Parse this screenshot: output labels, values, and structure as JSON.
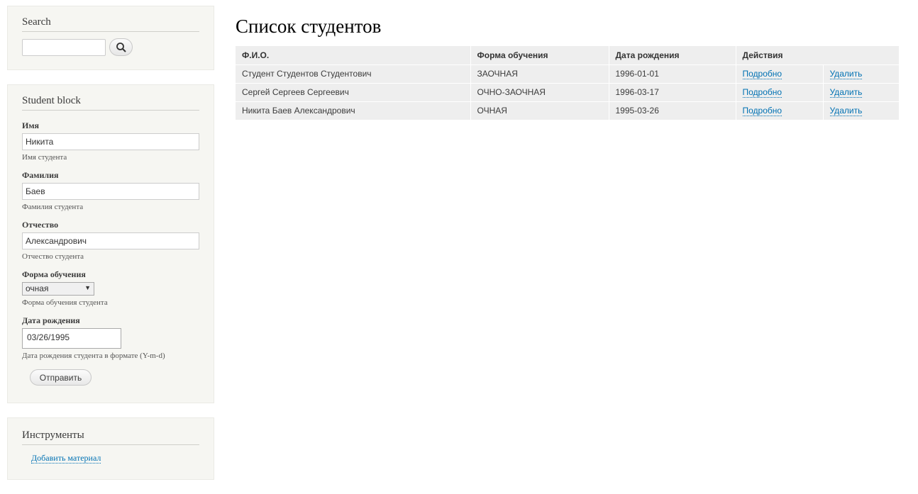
{
  "search": {
    "title": "Search",
    "input_value": "",
    "button_icon": "search-icon"
  },
  "student_block": {
    "title": "Student block",
    "first_name": {
      "label": "Имя",
      "value": "Никита",
      "description": "Имя студента"
    },
    "last_name": {
      "label": "Фамилия",
      "value": "Баев",
      "description": "Фамилия студента"
    },
    "patronymic": {
      "label": "Отчество",
      "value": "Александрович",
      "description": "Отчество студента"
    },
    "study_form": {
      "label": "Форма обучения",
      "value": "очная",
      "description": "Форма обучения студента"
    },
    "birth_date": {
      "label": "Дата рождения",
      "value": "03/26/1995",
      "description": "Дата рождения студента в формате (Y-m-d)"
    },
    "submit_label": "Отправить"
  },
  "tools": {
    "title": "Инструменты",
    "add_link": "Добавить материал"
  },
  "main": {
    "title": "Список студентов",
    "columns": [
      "Ф.И.О.",
      "Форма обучения",
      "Дата рождения",
      "Действия"
    ],
    "rows": [
      {
        "name": "Студент Студентов Студентович",
        "form": "ЗАОЧНАЯ",
        "date": "1996-01-01",
        "details": "Подробно",
        "delete": "Удалить"
      },
      {
        "name": "Сергей Сергеев Сергеевич",
        "form": "ОЧНО-ЗАОЧНАЯ",
        "date": "1996-03-17",
        "details": "Подробно",
        "delete": "Удалить"
      },
      {
        "name": "Никита Баев Александрович",
        "form": "ОЧНАЯ",
        "date": "1995-03-26",
        "details": "Подробно",
        "delete": "Удалить"
      }
    ]
  },
  "colors": {
    "link": "#0071b3",
    "block_bg": "#f6f6f2",
    "table_bg": "#eeeeee"
  }
}
